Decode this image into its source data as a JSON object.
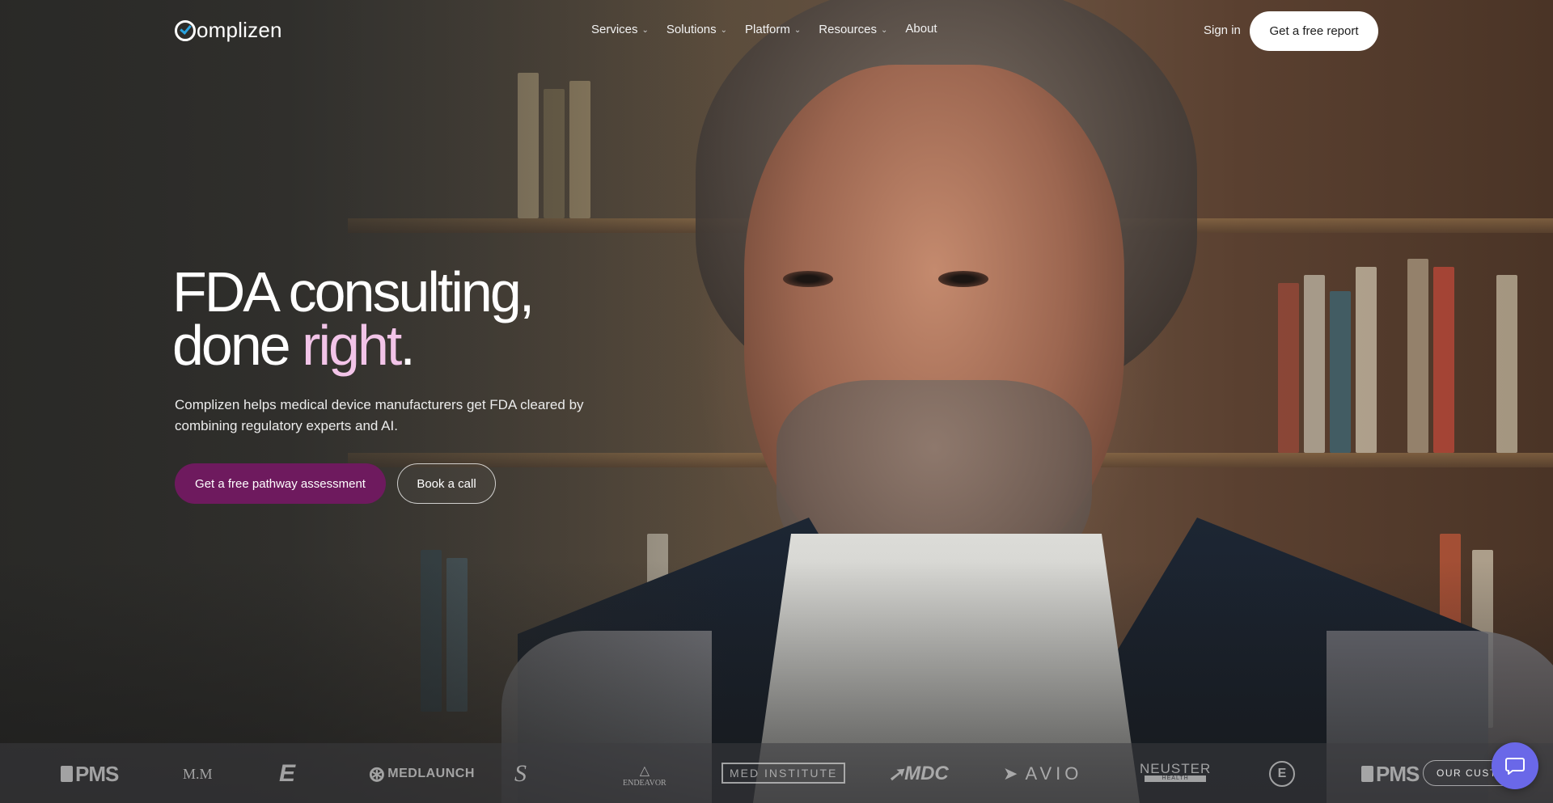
{
  "brand": {
    "logo_text": "omplizen",
    "accent_colors": {
      "primary_cta": "#6e1a5e",
      "title_accent": "#f2c4e8",
      "chat_button": "#6a68e8",
      "logo_check": "#2aa3e0"
    }
  },
  "header": {
    "nav": [
      {
        "label": "Services",
        "has_dropdown": true
      },
      {
        "label": "Solutions",
        "has_dropdown": true
      },
      {
        "label": "Platform",
        "has_dropdown": true
      },
      {
        "label": "Resources",
        "has_dropdown": true
      },
      {
        "label": "About",
        "has_dropdown": false
      }
    ],
    "sign_in": "Sign in",
    "report_button": "Get a free report"
  },
  "hero": {
    "title_line1": "FDA consulting,",
    "title_line2_prefix": "done ",
    "title_line2_accent": "right",
    "title_line2_suffix": ".",
    "subtitle": "Complizen helps medical device manufacturers get FDA cleared by combining regulatory experts and AI.",
    "primary_cta": "Get a free pathway assessment",
    "secondary_cta": "Book a call"
  },
  "clients": {
    "logos": [
      {
        "icon": "pms-logo",
        "text": "PMS"
      },
      {
        "icon": "mm-logo",
        "text": "M.M"
      },
      {
        "icon": "e-logo",
        "text": "E"
      },
      {
        "icon": "medlaunch-logo",
        "text": "MEDLAUNCH"
      },
      {
        "icon": "s-logo",
        "text": "S"
      },
      {
        "icon": "endeavor-logo",
        "text": "ENDEAVOR"
      },
      {
        "icon": "med-institute-logo",
        "text": "MED INSTITUTE"
      },
      {
        "icon": "mdc-logo",
        "text": "MDC"
      },
      {
        "icon": "avio-logo",
        "text": "AVIO"
      },
      {
        "icon": "neuster-logo",
        "text": "NEUSTER",
        "subtext": "HEALTH"
      },
      {
        "icon": "e-circle-logo",
        "text": "E"
      },
      {
        "icon": "pms-logo",
        "text": "PMS"
      }
    ],
    "customers_pill": "OUR CUSTOMERS"
  },
  "chat": {
    "icon": "chat-icon"
  }
}
